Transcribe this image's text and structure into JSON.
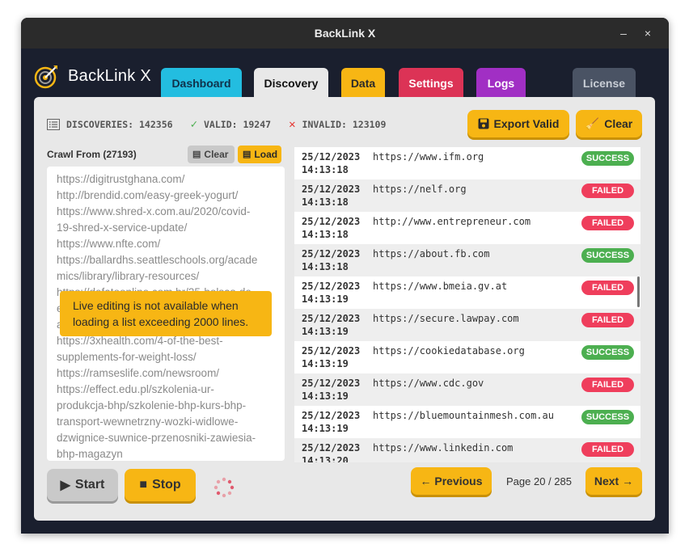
{
  "window": {
    "title": "BackLink X",
    "minimize_glyph": "–",
    "close_glyph": "×"
  },
  "logo": {
    "text_bold": "Back",
    "text_thin": "Link X"
  },
  "tabs": [
    {
      "label": "Dashboard"
    },
    {
      "label": "Discovery"
    },
    {
      "label": "Data"
    },
    {
      "label": "Settings"
    },
    {
      "label": "Logs"
    },
    {
      "label": "License"
    }
  ],
  "stats": {
    "discoveries": "DISCOVERIES: 142356",
    "valid": "VALID: 19247",
    "invalid": "INVALID: 123109"
  },
  "actions": {
    "export_label": "Export Valid",
    "clear_label": "Clear"
  },
  "crawl": {
    "label": "Crawl From (27193)",
    "clear_label": "Clear",
    "load_label": "Load",
    "lines": [
      "https://digitrustghana.com/",
      "http://brendid.com/easy-greek-yogurt/",
      "https://www.shred-x.com.au/2020/covid-",
      "19-shred-x-service-update/",
      "https://www.nfte.com/",
      "https://ballardhs.seattleschools.org/acade",
      "mics/library/library-resources/",
      "https://defatoonline.com.br/35-bolsas-de",
      "e",
      "a",
      "https://3xhealth.com/4-of-the-best-",
      "supplements-for-weight-loss/",
      "https://ramseslife.com/newsroom/",
      "https://effect.edu.pl/szkolenia-ur-",
      "produkcja-bhp/szkolenie-bhp-kurs-bhp-",
      "transport-wewnetrzny-wozki-widlowe-",
      "dzwignice-suwnice-przenosniki-zawiesia-",
      "bhp-magazyn"
    ],
    "toast": "Live editing is not available when loading a list exceeding 2000 lines."
  },
  "controls": {
    "start_label": "Start",
    "stop_label": "Stop"
  },
  "results": [
    {
      "date": "25/12/2023",
      "time": "14:13:18",
      "url": "https://www.ifm.org",
      "status": "SUCCESS"
    },
    {
      "date": "25/12/2023",
      "time": "14:13:18",
      "url": "https://nelf.org",
      "status": "FAILED"
    },
    {
      "date": "25/12/2023",
      "time": "14:13:18",
      "url": "http://www.entrepreneur.com",
      "status": "FAILED"
    },
    {
      "date": "25/12/2023",
      "time": "14:13:18",
      "url": "https://about.fb.com",
      "status": "SUCCESS"
    },
    {
      "date": "25/12/2023",
      "time": "14:13:19",
      "url": "https://www.bmeia.gv.at",
      "status": "FAILED"
    },
    {
      "date": "25/12/2023",
      "time": "14:13:19",
      "url": "https://secure.lawpay.com",
      "status": "FAILED"
    },
    {
      "date": "25/12/2023",
      "time": "14:13:19",
      "url": "https://cookiedatabase.org",
      "status": "SUCCESS"
    },
    {
      "date": "25/12/2023",
      "time": "14:13:19",
      "url": "https://www.cdc.gov",
      "status": "FAILED"
    },
    {
      "date": "25/12/2023",
      "time": "14:13:19",
      "url": "https://bluemountainmesh.com.au",
      "status": "SUCCESS"
    },
    {
      "date": "25/12/2023",
      "time": "14:13:20",
      "url": "https://www.linkedin.com",
      "status": "FAILED"
    }
  ],
  "pagination": {
    "prev_label": "← Previous",
    "next_label": "Next →",
    "page_text": "Page 20 / 285"
  },
  "colors": {
    "accent_yellow": "#f7b614",
    "success": "#4caf50",
    "failed": "#ef3e5c",
    "window_bg": "#1a1f2e"
  }
}
